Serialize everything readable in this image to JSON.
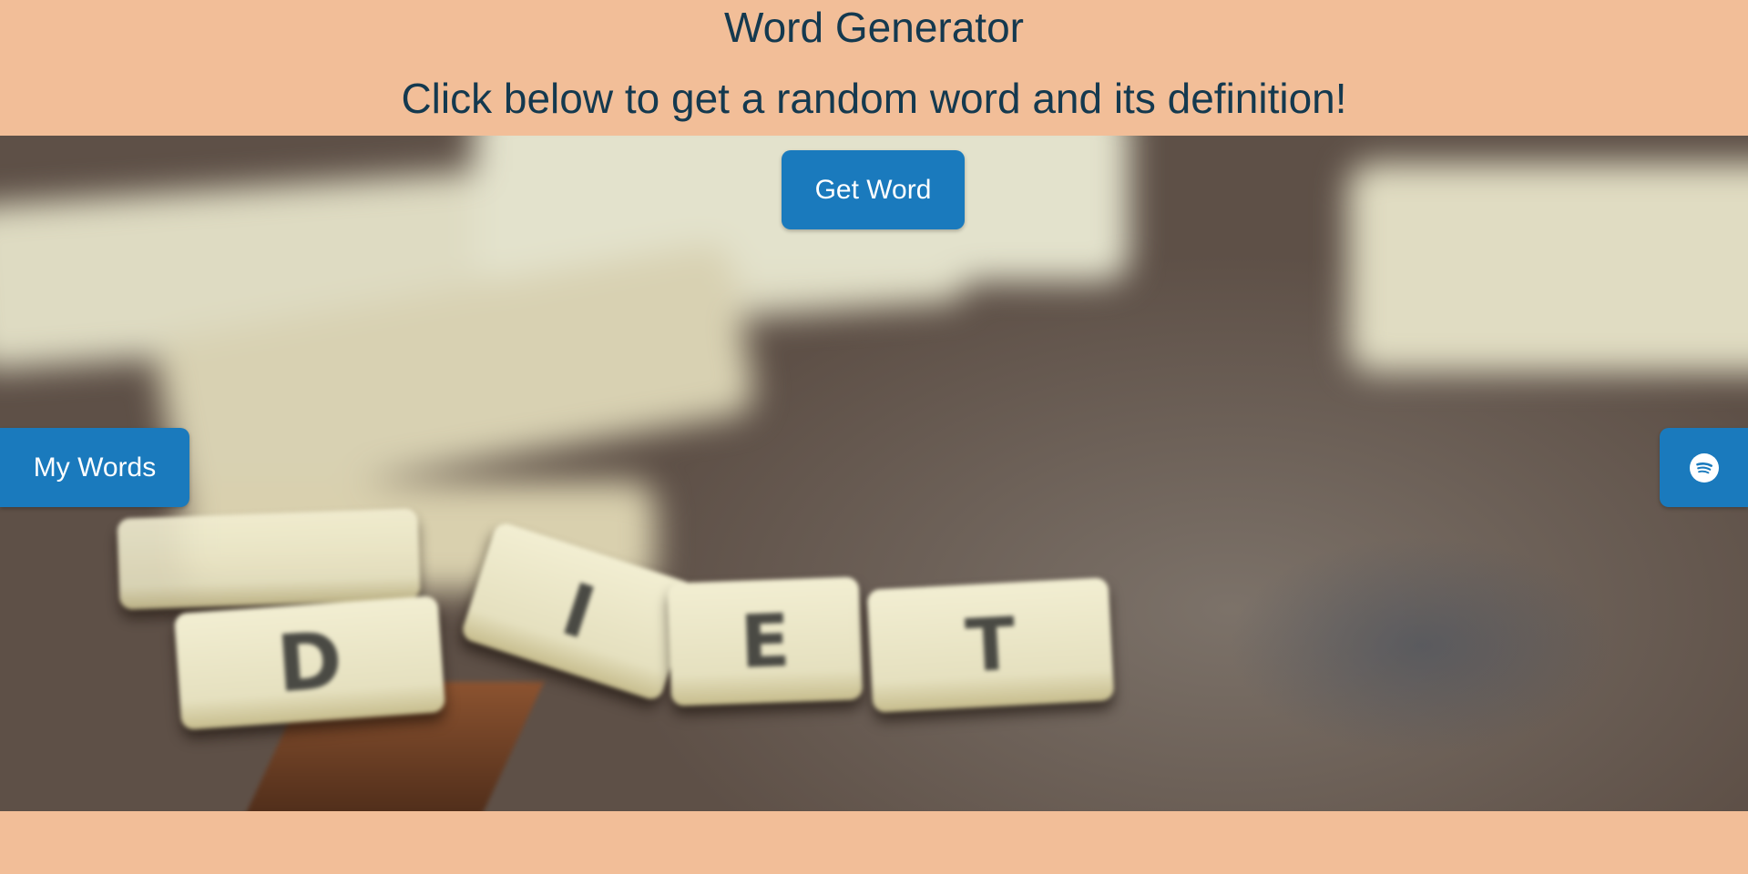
{
  "header": {
    "title": "Word Generator",
    "subtitle": "Click below to get a random word and its definition!"
  },
  "hero": {
    "background_image": "blurred-scrabble-tiles-on-wooden-table",
    "tiles": [
      "D",
      "I",
      "E",
      "T"
    ]
  },
  "buttons": {
    "get_word_label": "Get Word",
    "my_words_label": "My Words",
    "spotify_icon": "spotify-icon"
  },
  "colors": {
    "page_background": "#f2be98",
    "heading_text": "#14394f",
    "button_background": "#1a7abd",
    "button_text": "#ffffff"
  }
}
